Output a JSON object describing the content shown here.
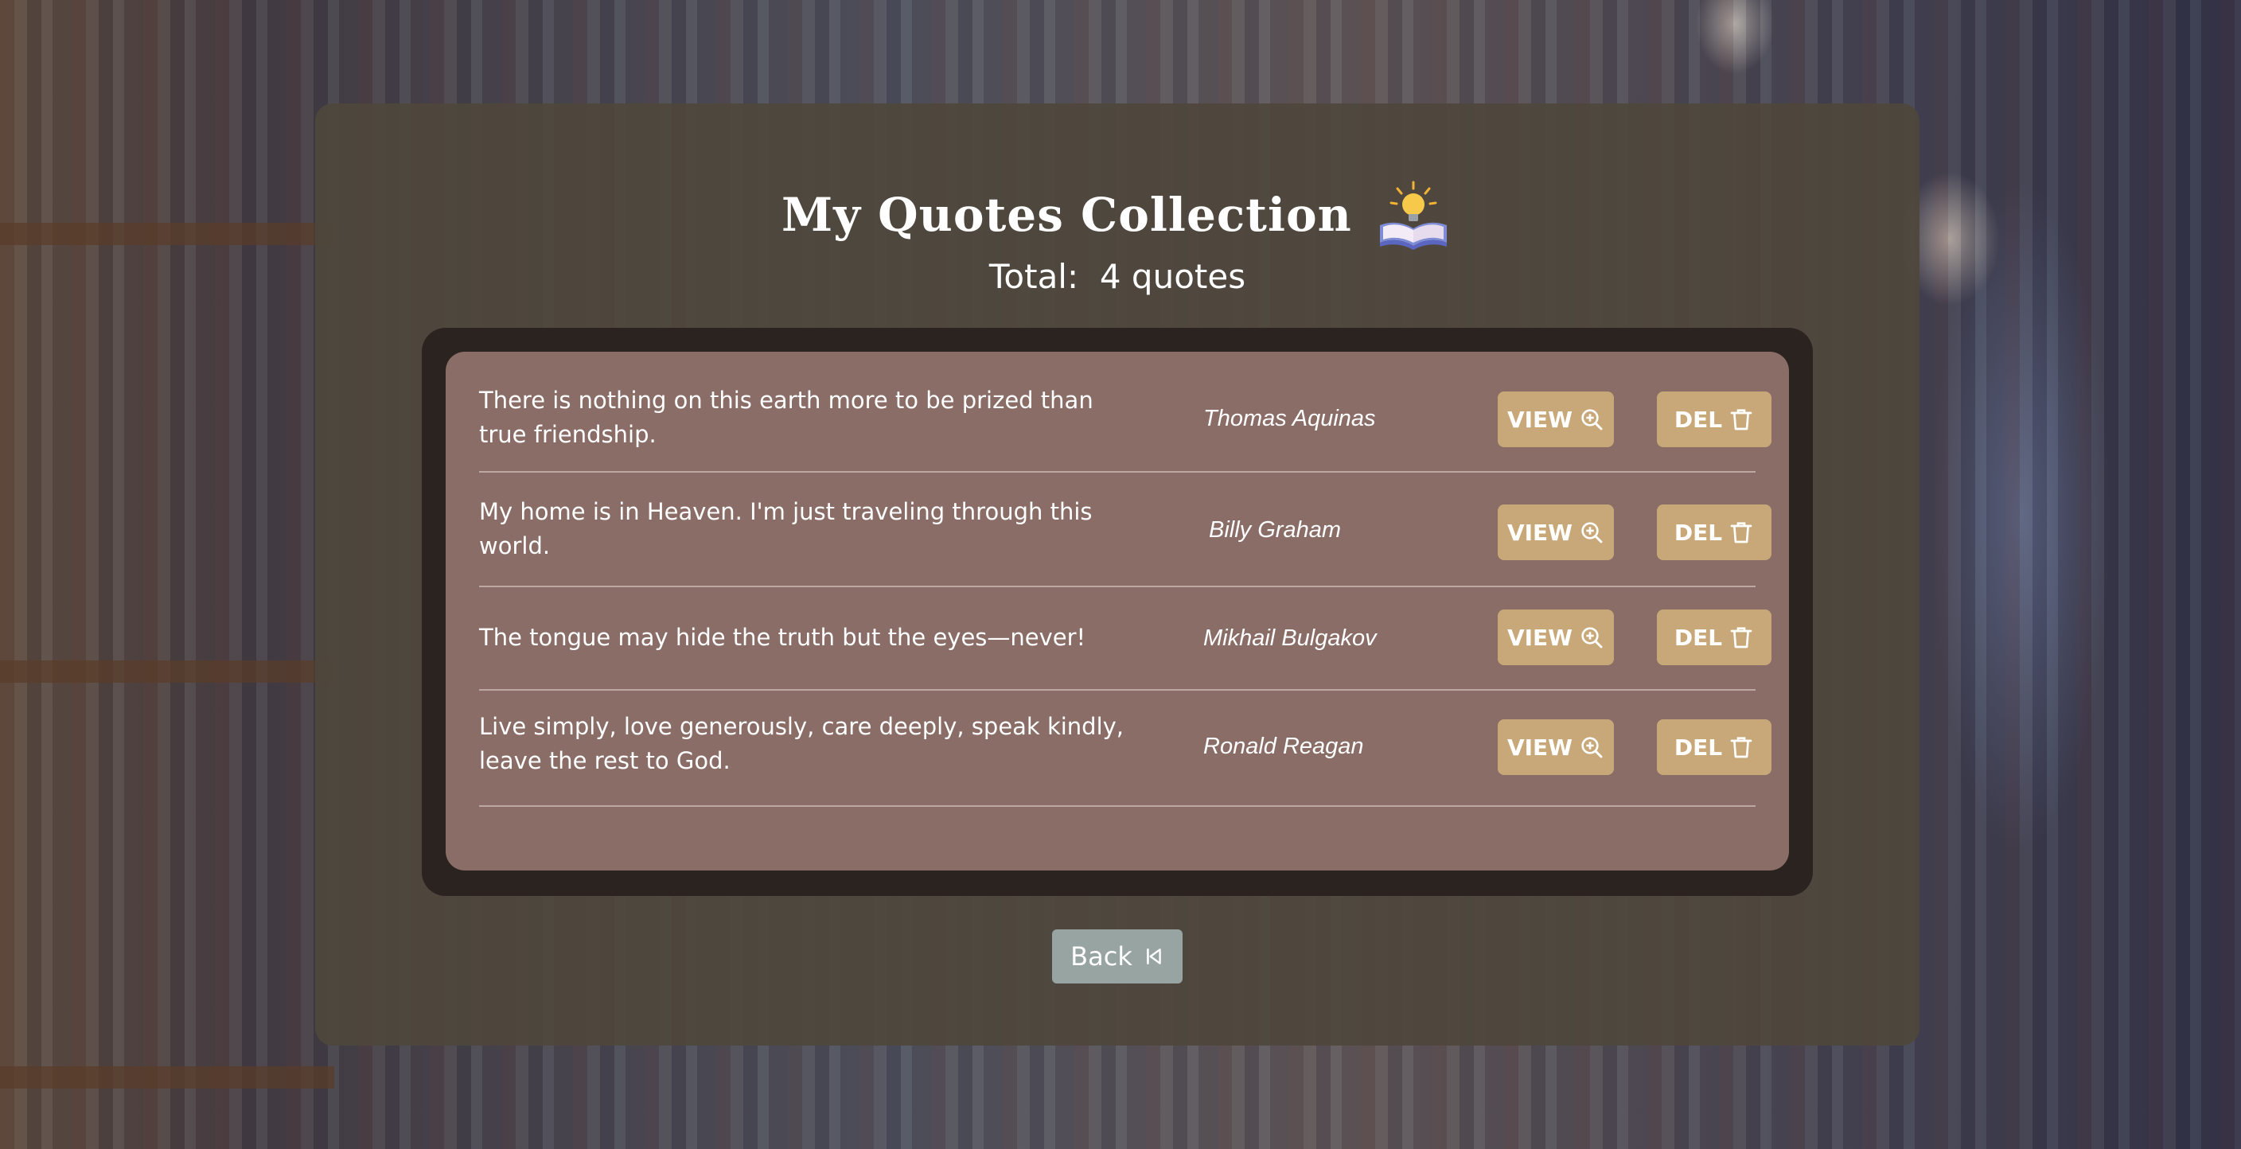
{
  "header": {
    "title": "My Quotes Collection",
    "icon": "book-with-lightbulb-icon"
  },
  "summary": {
    "total_label": "Total:",
    "total_value": "4 quotes"
  },
  "quotes": [
    {
      "text": "There is nothing on this earth more to be prized than true friendship.",
      "author": "Thomas Aquinas",
      "view_label": "VIEW",
      "del_label": "DEL"
    },
    {
      "text": "My home is in Heaven. I'm just traveling through this world.",
      "author": "Billy Graham",
      "view_label": "VIEW",
      "del_label": "DEL"
    },
    {
      "text": "The tongue may hide the truth but the eyes—never!",
      "author": "Mikhail Bulgakov",
      "view_label": "VIEW",
      "del_label": "DEL"
    },
    {
      "text": "Live simply, love generously, care deeply, speak kindly, leave the rest to God.",
      "author": "Ronald Reagan",
      "view_label": "VIEW",
      "del_label": "DEL"
    }
  ],
  "footer": {
    "back_label": "Back",
    "back_icon": "skip-back-icon"
  },
  "colors": {
    "panel": "#4f473c",
    "list_frame": "#2a231f",
    "list_bg": "#8a6d67",
    "action_button": "#c8a878",
    "back_button": "#97a4a2"
  }
}
